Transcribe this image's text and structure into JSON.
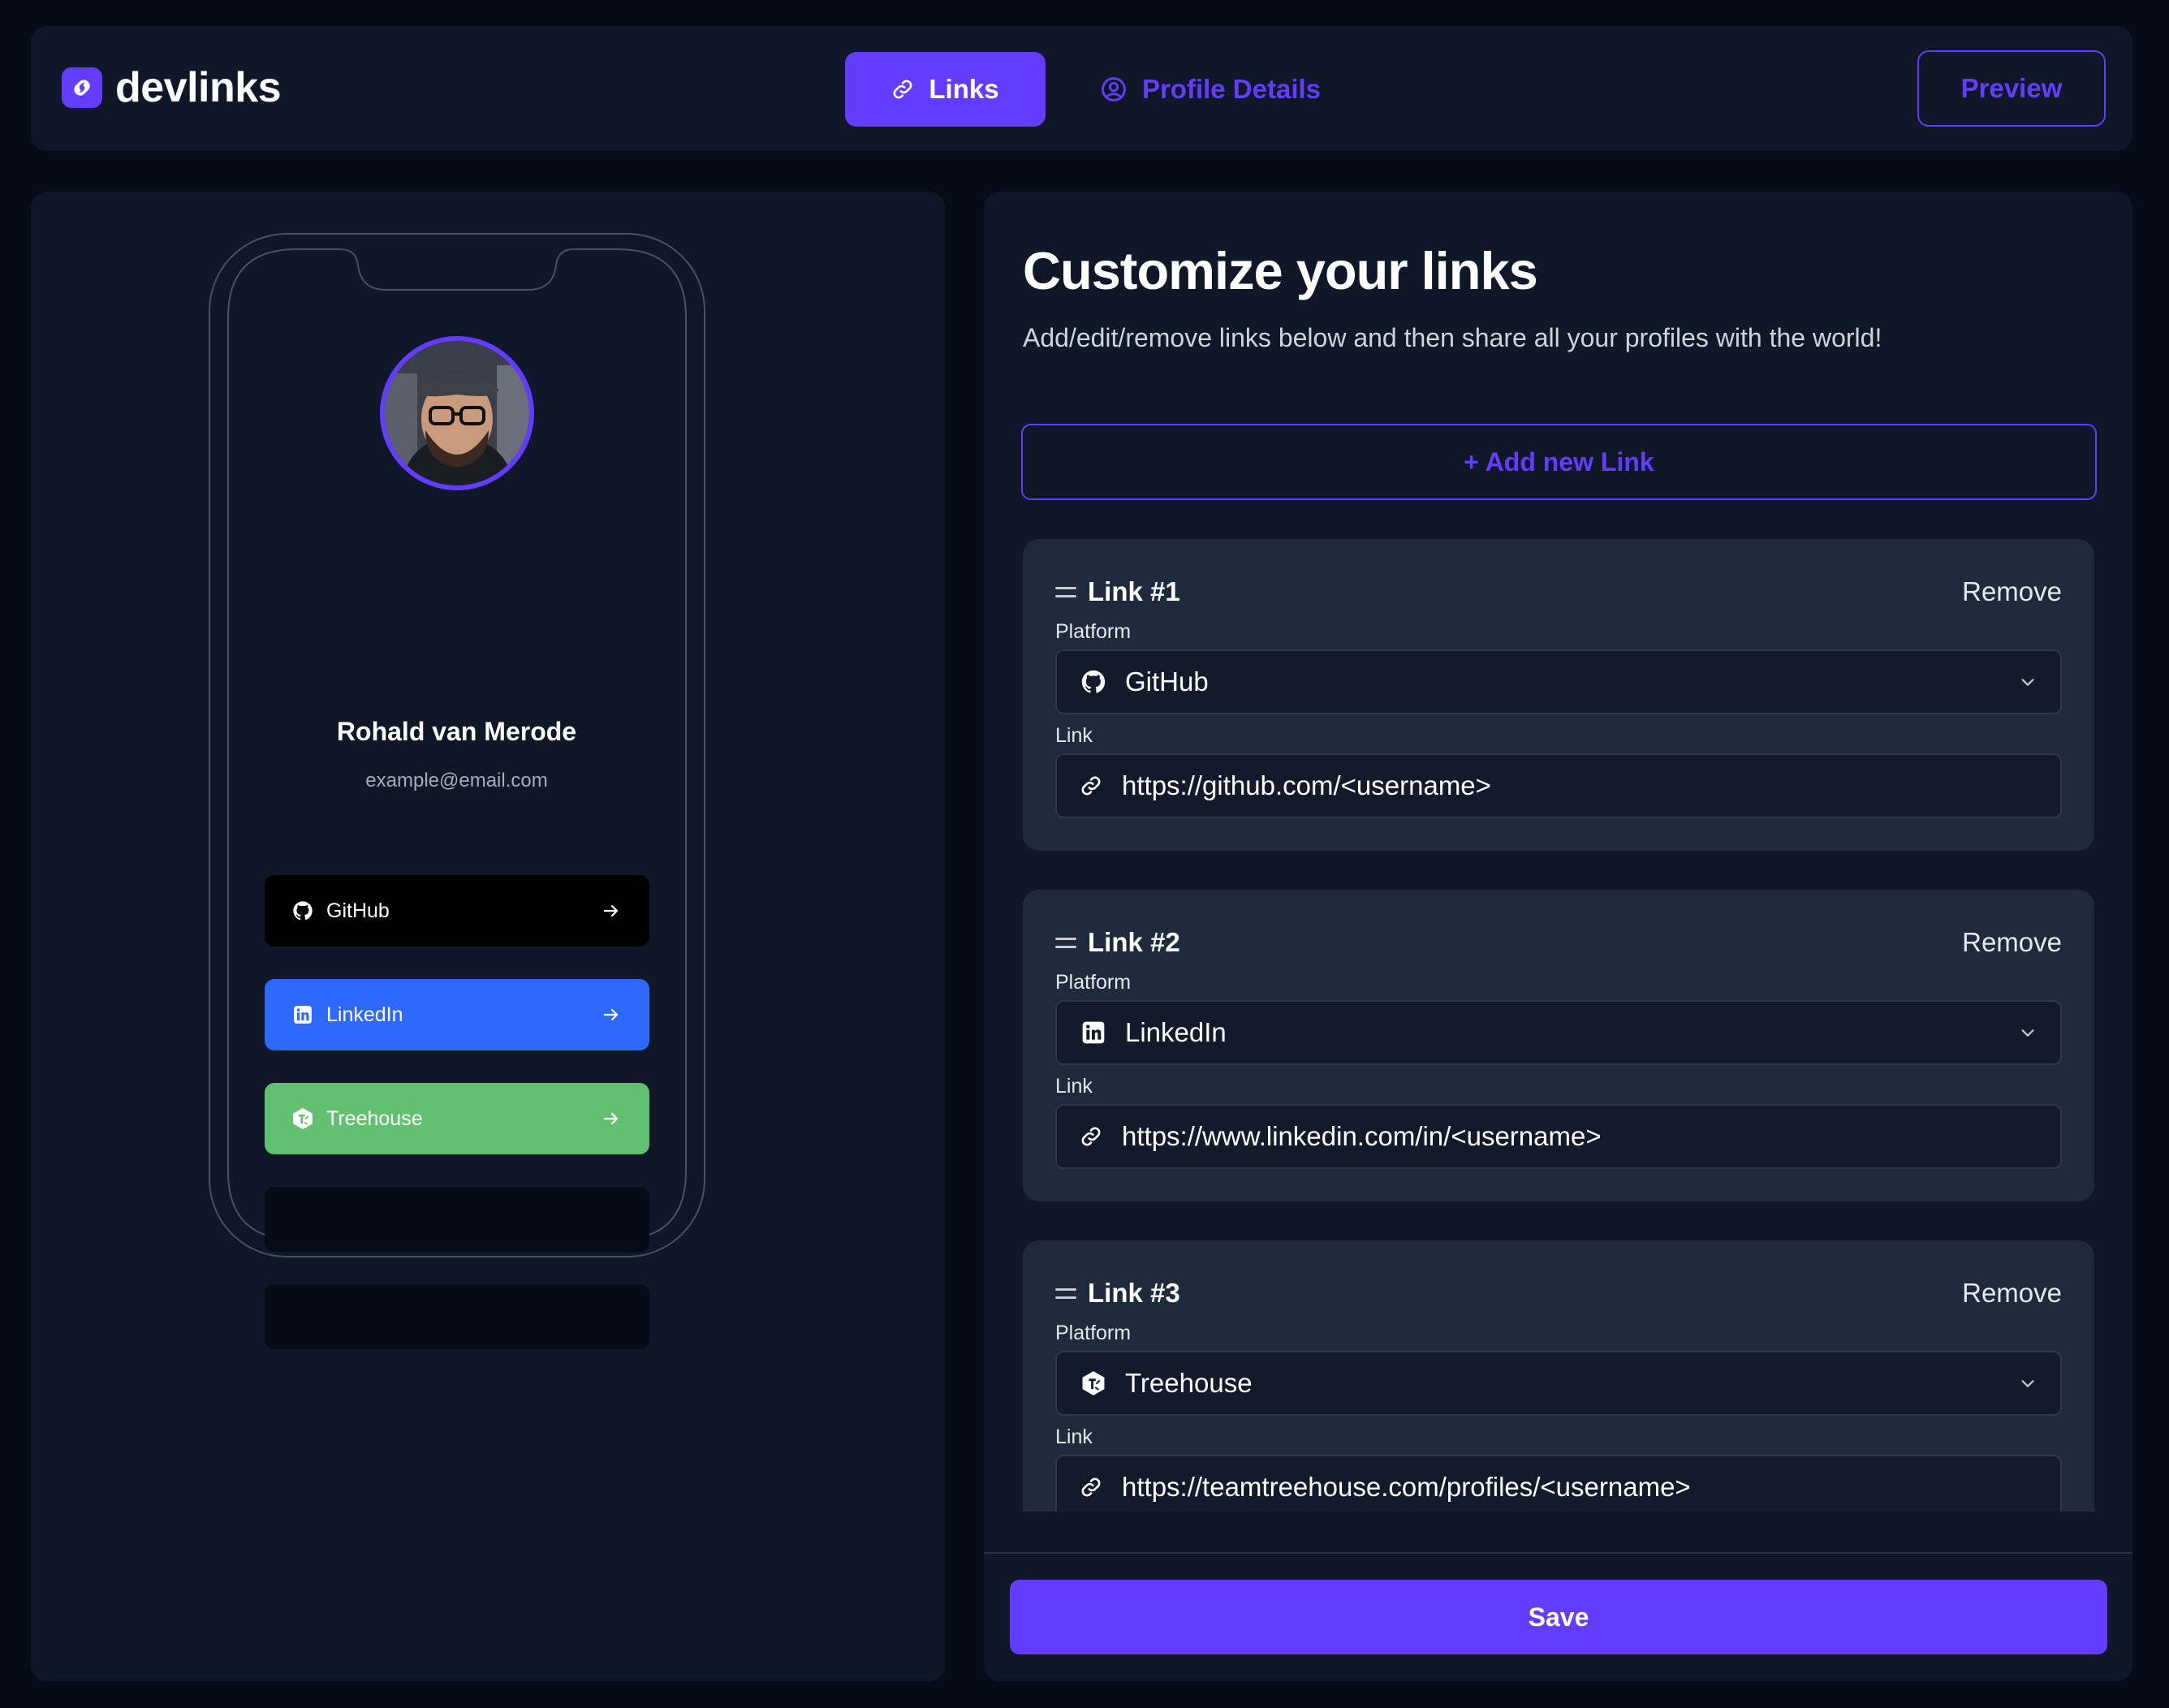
{
  "app": {
    "name": "devlinks"
  },
  "nav": {
    "tabs": [
      {
        "label": "Links",
        "icon": "link-icon",
        "active": true
      },
      {
        "label": "Profile Details",
        "icon": "user-circle-icon",
        "active": false
      }
    ],
    "preview_label": "Preview"
  },
  "profile": {
    "name": "Rohald van Merode",
    "email": "example@email.com",
    "links": [
      {
        "label": "GitHub",
        "icon": "github-icon",
        "color": "#000000"
      },
      {
        "label": "LinkedIn",
        "icon": "linkedin-icon",
        "color": "#2d68ff"
      },
      {
        "label": "Treehouse",
        "icon": "treehouse-icon",
        "color": "#63c071"
      }
    ]
  },
  "editor": {
    "title": "Customize your links",
    "subtitle": "Add/edit/remove links below and then share all your profiles with the world!",
    "add_label": "+ Add new Link",
    "platform_label": "Platform",
    "link_label": "Link",
    "remove_label": "Remove",
    "links": [
      {
        "title": "Link #1",
        "platform": "GitHub",
        "url": "https://github.com/<username>"
      },
      {
        "title": "Link #2",
        "platform": "LinkedIn",
        "url": "https://www.linkedin.com/in/<username>"
      },
      {
        "title": "Link #3",
        "platform": "Treehouse",
        "url": "https://teamtreehouse.com/profiles/<username>"
      }
    ],
    "save_label": "Save"
  },
  "colors": {
    "accent": "#633cff",
    "background": "#070b18",
    "panel": "#101729",
    "card": "#1f2a3d"
  }
}
